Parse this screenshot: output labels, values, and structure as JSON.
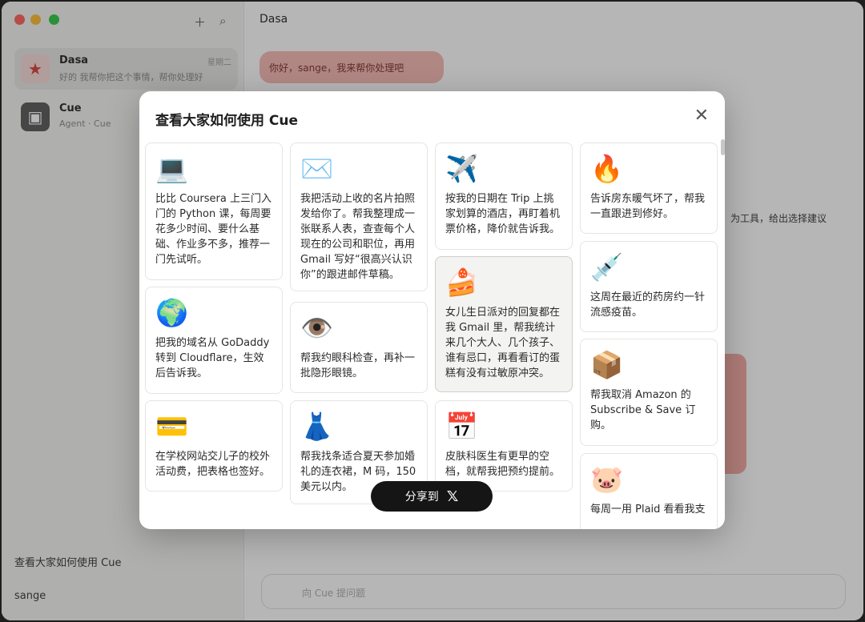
{
  "sidebar": {
    "chats": [
      {
        "title": "Dasa",
        "subtitle": "好的 我帮你把这个事情，帮你处理好",
        "time": "星期二"
      },
      {
        "title": "Cue",
        "subtitle": "Agent · Cue",
        "time": ""
      }
    ],
    "footer_link": "查看大家如何使用 Cue",
    "user_name": "sange"
  },
  "main": {
    "title": "Dasa",
    "pill": "你好，sange，我来帮你处理吧",
    "side_text": "为工具，给出选择建议",
    "input_placeholder": "向 Cue 提问题"
  },
  "modal": {
    "title": "查看大家如何使用 Cue",
    "close": "✕",
    "cards": [
      {
        "icon": "laptop-icon",
        "emoji": "💻",
        "text": "比比 Coursera 上三门入门的 Python 课，每周要花多少时间、要什么基础、作业多不多，推荐一门先试听。"
      },
      {
        "icon": "globe-icon",
        "emoji": "🌍",
        "text": "把我的域名从 GoDaddy 转到 Cloudflare，生效后告诉我。"
      },
      {
        "icon": "credit-card-icon",
        "emoji": "💳",
        "text": "在学校网站交儿子的校外活动费，把表格也签好。"
      },
      {
        "icon": "envelope-icon",
        "emoji": "✉️",
        "text": "我把活动上收的名片拍照发给你了。帮我整理成一张联系人表，查查每个人现在的公司和职位，再用 Gmail 写好“很高兴认识你”的跟进邮件草稿。"
      },
      {
        "icon": "eye-icon",
        "emoji": "👁️",
        "text": "帮我约眼科检查，再补一批隐形眼镜。"
      },
      {
        "icon": "dress-icon",
        "emoji": "👗",
        "text": "帮我找条适合夏天参加婚礼的连衣裙，M 码，150 美元以内。"
      },
      {
        "icon": "airplane-icon",
        "emoji": "✈️",
        "text": "按我的日期在 Trip 上挑家划算的酒店，再盯着机票价格，降价就告诉我。"
      },
      {
        "icon": "cake-icon",
        "emoji": "🍰",
        "text": "女儿生日派对的回复都在我 Gmail 里，帮我统计来几个大人、几个孩子、谁有忌口，再看看订的蛋糕有没有过敏原冲突。"
      },
      {
        "icon": "calendar-icon",
        "emoji": "📅",
        "text": "皮肤科医生有更早的空档，就帮我把预约提前。"
      },
      {
        "icon": "radiator-icon",
        "emoji": "🔥",
        "text": "告诉房东暖气坏了，帮我一直跟进到修好。"
      },
      {
        "icon": "syringe-icon",
        "emoji": "💉",
        "text": "这周在最近的药房约一针流感疫苗。"
      },
      {
        "icon": "package-icon",
        "emoji": "📦",
        "text": "帮我取消 Amazon 的 Subscribe & Save 订购。"
      },
      {
        "icon": "piggy-bank-icon",
        "emoji": "🐷",
        "text": "每周一用 Plaid 看看我支"
      }
    ]
  },
  "share": {
    "label": "分享到",
    "brand": "𝕏"
  }
}
